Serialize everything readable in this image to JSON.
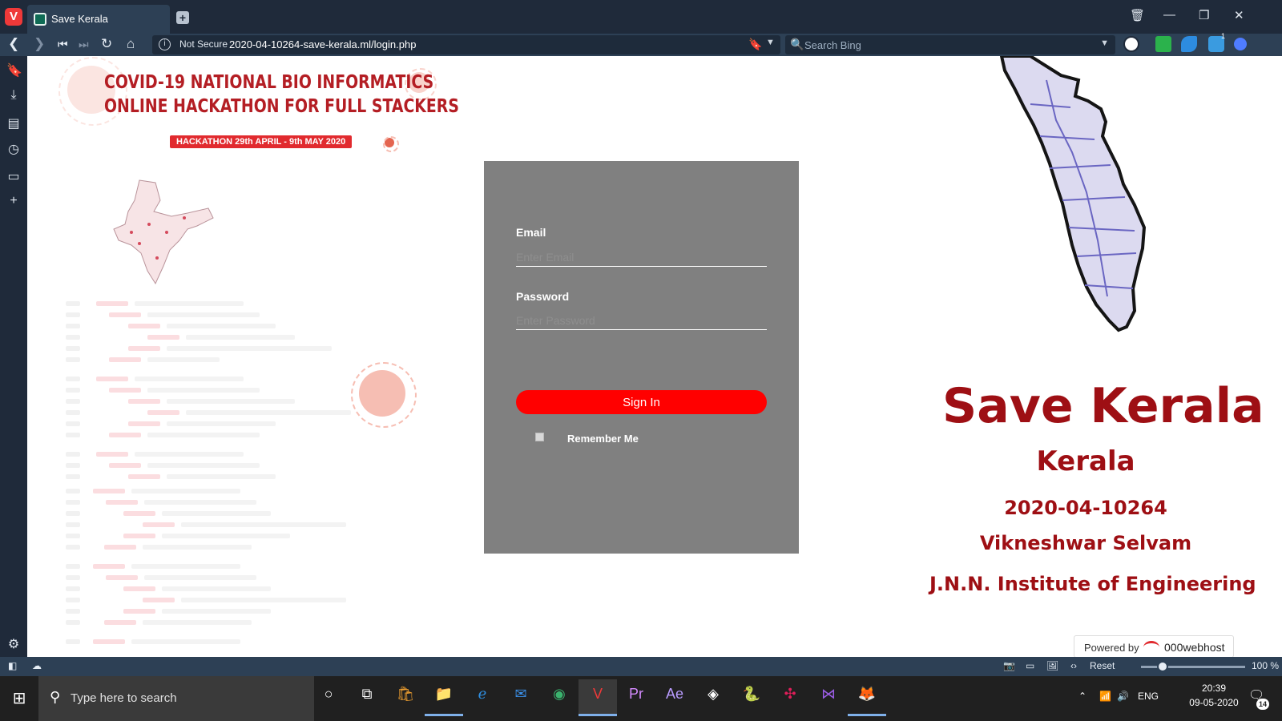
{
  "browser": {
    "tab_title": "Save Kerala",
    "security_label": "Not Secure",
    "url": "2020-04-10264-save-kerala.ml/login.php",
    "search_placeholder": "Search Bing",
    "extension_badge": "1",
    "status": {
      "reset_label": "Reset",
      "zoom": "100 %"
    }
  },
  "page": {
    "hackathon_title_line1": "COVID-19 NATIONAL BIO INFORMATICS",
    "hackathon_title_line2": "ONLINE HACKATHON FOR FULL STACKERS",
    "hackathon_dates": "HACKATHON  29th APRIL - 9th MAY 2020",
    "login": {
      "email_label": "Email",
      "email_placeholder": "Enter Email",
      "password_label": "Password",
      "password_placeholder": "Enter Password",
      "signin_label": "Sign In",
      "remember_label": "Remember Me"
    },
    "brand": {
      "title": "Save Kerala",
      "subtitle": "Kerala",
      "id": "2020-04-10264",
      "author": "Vikneshwar Selvam",
      "institute": "J.N.N. Institute of Engineering"
    },
    "powered_by": {
      "label": "Powered by",
      "name": "000webhost"
    }
  },
  "taskbar": {
    "search_placeholder": "Type here to search",
    "language": "ENG",
    "time": "20:39",
    "date": "09-05-2020",
    "notifications": "14"
  },
  "colors": {
    "accent_red": "#ff0000",
    "brand_red": "#9e0f14",
    "panel_gray": "#808080",
    "chrome": "#1f2a3a"
  }
}
